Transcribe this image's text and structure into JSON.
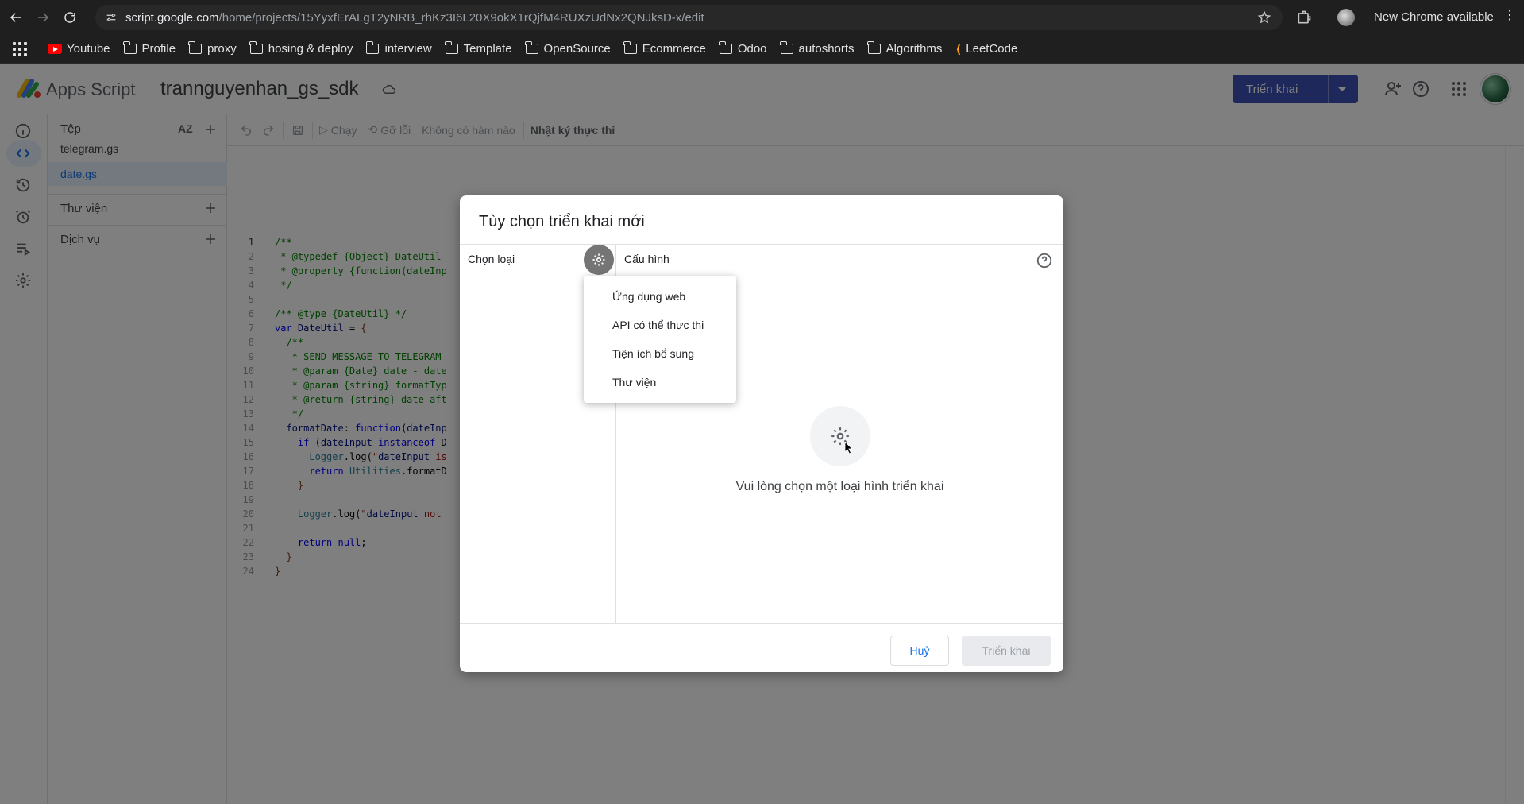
{
  "browser": {
    "url_host": "script.google.com",
    "url_path": "/home/projects/15YyxfErALgT2yNRB_rhKz3I6L20X9okX1rQjfM4RUXzUdNx2QNJksD-x/edit",
    "new_chrome_label": "New Chrome available"
  },
  "bookmarks": [
    "Youtube",
    "Profile",
    "proxy",
    "hosing & deploy",
    "interview",
    "Template",
    "OpenSource",
    "Ecommerce",
    "Odoo",
    "autoshorts",
    "Algorithms",
    "LeetCode"
  ],
  "app": {
    "name": "Apps Script",
    "project_title": "trannguyenhan_gs_sdk",
    "deploy_label": "Triển khai"
  },
  "files_panel": {
    "header": "Tệp",
    "sort_label": "AZ",
    "files": [
      "telegram.gs",
      "date.gs"
    ],
    "active_file": "date.gs",
    "libraries_label": "Thư viện",
    "services_label": "Dịch vụ"
  },
  "toolbar": {
    "run_label": "Chạy",
    "debug_label": "Gỡ lỗi",
    "function_label": "Không có hàm nào",
    "log_label": "Nhật ký thực thi"
  },
  "code_lines": [
    "/**",
    " * @typedef {Object} DateUtil",
    " * @property {function(dateInp",
    " */",
    "",
    "/** @type {DateUtil} */",
    "var DateUtil = {",
    "  /**",
    "   * SEND MESSAGE TO TELEGRAM",
    "   * @param {Date} date - date",
    "   * @param {string} formatTyp",
    "   * @return {string} date aft",
    "   */",
    "  formatDate: function(dateInp",
    "    if (dateInput instanceof D",
    "      Logger.log(\"dateInput is",
    "      return Utilities.formatD",
    "    }",
    "",
    "    Logger.log(\"dateInput not",
    "",
    "    return null;",
    "  }",
    "}"
  ],
  "dialog": {
    "title": "Tùy chọn triển khai mới",
    "choose_type_label": "Chọn loại",
    "config_label": "Cấu hình",
    "empty_message": "Vui lòng chọn một loại hình triển khai",
    "cancel_label": "Huỷ",
    "deploy_label": "Triển khai",
    "type_options": [
      "Ứng dụng web",
      "API có thể thực thi",
      "Tiện ích bổ sung",
      "Thư viện"
    ]
  },
  "colors": {
    "deploy_button": "#3c51b4",
    "active_file": "#1a73e8",
    "overlay": "rgba(0,0,0,0.5)"
  }
}
